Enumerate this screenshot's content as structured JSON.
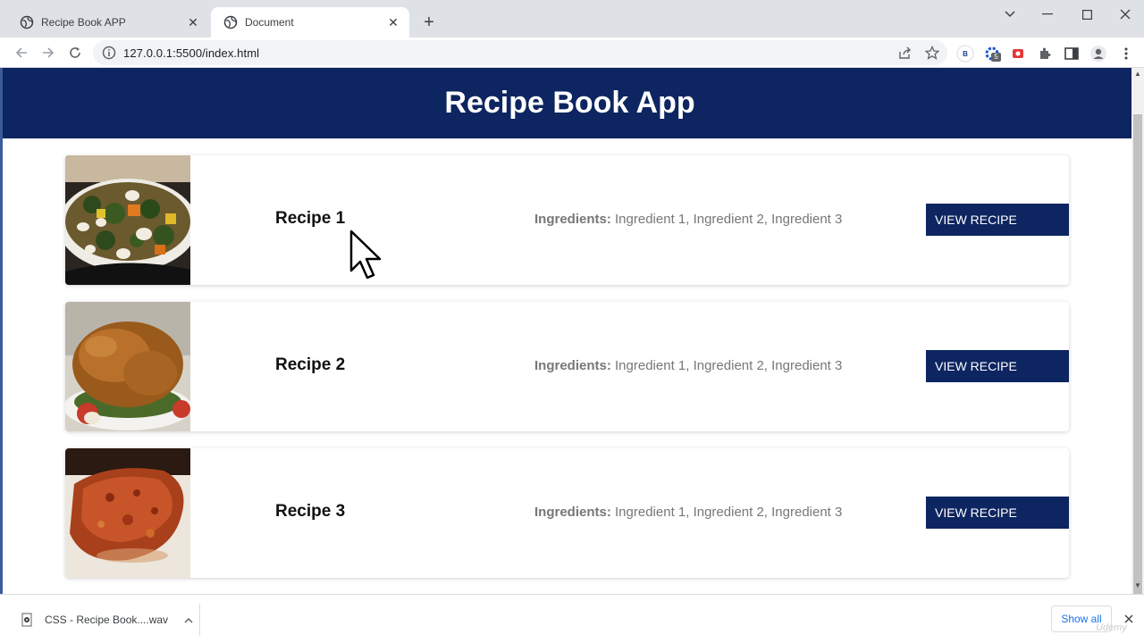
{
  "browser": {
    "tabs": [
      {
        "title": "Recipe Book APP",
        "active": false
      },
      {
        "title": "Document",
        "active": true
      }
    ],
    "url": "127.0.0.1:5500/index.html",
    "extension_badge": "5",
    "extension_b_label": "B"
  },
  "app": {
    "title": "Recipe Book App",
    "colors": {
      "primary": "#0d2560",
      "text_muted": "#777777"
    }
  },
  "recipes": [
    {
      "title": "Recipe 1",
      "ingredients_label": "Ingredients:",
      "ingredients": "Ingredient 1, Ingredient 2, Ingredient 3",
      "button": "VIEW RECIPE",
      "image": "vegetable-soup"
    },
    {
      "title": "Recipe 2",
      "ingredients_label": "Ingredients:",
      "ingredients": "Ingredient 1, Ingredient 2, Ingredient 3",
      "button": "VIEW RECIPE",
      "image": "roast-chicken"
    },
    {
      "title": "Recipe 3",
      "ingredients_label": "Ingredients:",
      "ingredients": "Ingredient 1, Ingredient 2, Ingredient 3",
      "button": "VIEW RECIPE",
      "image": "glazed-meatloaf"
    }
  ],
  "downloads": {
    "file_name": "CSS - Recipe Book....wav",
    "show_all": "Show all"
  },
  "watermark": "Udemy"
}
